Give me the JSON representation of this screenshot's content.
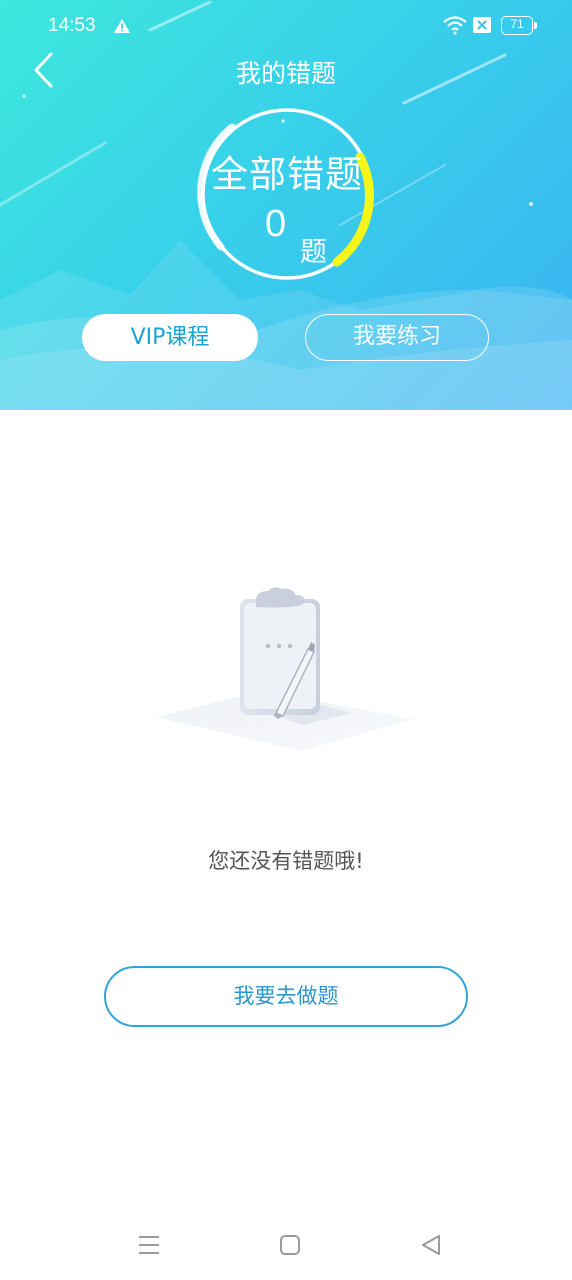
{
  "status_bar": {
    "time": "14:53",
    "battery": "71",
    "icons": [
      "warning-icon",
      "wifi-icon",
      "sim-x-icon",
      "battery-icon"
    ]
  },
  "header": {
    "title": "我的错题",
    "back_icon": "chevron-left-icon"
  },
  "summary": {
    "label": "全部错题",
    "count": "0",
    "unit": "题",
    "ring_color": "#ffffff",
    "ring_accent_color": "#f5f51a"
  },
  "actions": {
    "vip_label": "VIP课程",
    "practice_label": "我要练习"
  },
  "empty_state": {
    "illustration": "clipboard-pen-icon",
    "message": "您还没有错题哦!",
    "button_label": "我要去做题"
  },
  "nav_bar": {
    "icons": [
      "menu-icon",
      "home-icon",
      "back-triangle-icon"
    ]
  },
  "colors": {
    "accent": "#2a97d0",
    "header_gradient_start": "#3ee8dc",
    "header_gradient_end": "#3ab2f3"
  }
}
